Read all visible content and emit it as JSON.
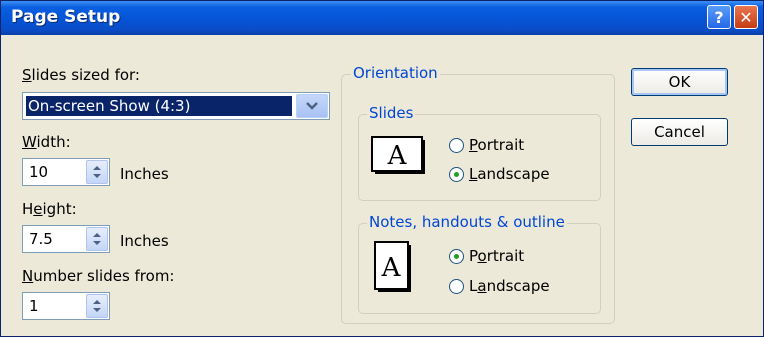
{
  "window": {
    "title": "Page Setup",
    "help_glyph": "?",
    "close_glyph": "✕"
  },
  "left": {
    "slides_sized_for": {
      "label_key": "S",
      "label_rest": "lides sized for:",
      "value": "On-screen Show (4:3)"
    },
    "width": {
      "label_key": "W",
      "label_rest": "idth:",
      "value": "10",
      "unit": "Inches"
    },
    "height": {
      "label_pre": "H",
      "label_key": "e",
      "label_rest": "ight:",
      "value": "7.5",
      "unit": "Inches"
    },
    "number_from": {
      "label_key": "N",
      "label_rest": "umber slides from:",
      "value": "1"
    }
  },
  "orientation": {
    "title": "Orientation",
    "slides": {
      "title": "Slides",
      "portrait": {
        "key": "P",
        "rest": "ortrait"
      },
      "landscape": {
        "key": "L",
        "rest": "andscape"
      },
      "selected": "landscape"
    },
    "notes": {
      "title": "Notes, handouts & outline",
      "portrait": {
        "pre": "P",
        "key": "o",
        "rest": "rtrait"
      },
      "landscape": {
        "pre": "L",
        "key": "a",
        "rest": "ndscape"
      },
      "selected": "portrait"
    },
    "icon_letter": "A"
  },
  "buttons": {
    "ok": "OK",
    "cancel": "Cancel"
  }
}
